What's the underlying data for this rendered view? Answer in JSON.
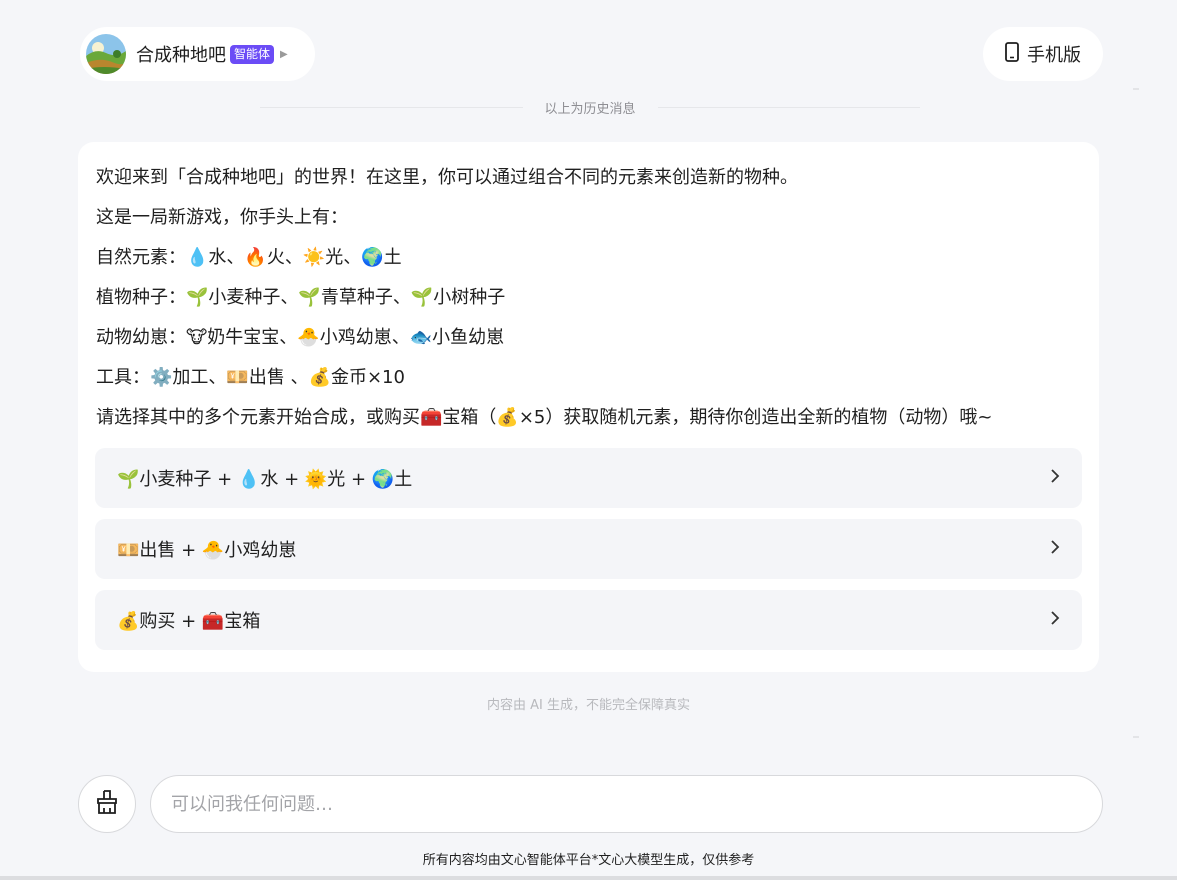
{
  "header": {
    "agent_name": "合成种地吧",
    "agent_badge": "智能体",
    "mobile_label": "手机版"
  },
  "history_divider": "以上为历史消息",
  "message": {
    "lines": [
      "欢迎来到「合成种地吧」的世界！在这里，你可以通过组合不同的元素来创造新的物种。",
      "这是一局新游戏，你手头上有：",
      "自然元素：💧水、🔥火、☀️光、🌍土",
      "植物种子：🌱小麦种子、🌱青草种子、🌱小树种子",
      "动物幼崽：🐮奶牛宝宝、🐣小鸡幼崽、🐟小鱼幼崽",
      "工具：⚙️加工、💴出售 、💰金币×10",
      "请选择其中的多个元素开始合成，或购买🧰宝箱（💰×5）获取随机元素，期待你创造出全新的植物（动物）哦~"
    ]
  },
  "suggestions": [
    "🌱小麦种子 + 💧水 + 🌞光 + 🌍土",
    "💴出售 + 🐣小鸡幼崽",
    "💰购买 + 🧰宝箱"
  ],
  "ai_note": "内容由 AI 生成，不能完全保障真实",
  "input": {
    "placeholder": "可以问我任何问题…"
  },
  "footer_note": "所有内容均由文心智能体平台*文心大模型生成，仅供参考",
  "icons": {
    "avatar": "farm-landscape-avatar",
    "mobile": "phone-icon",
    "tool": "broom-icon",
    "suggestion_arrow": "chevron-right-icon"
  },
  "colors": {
    "badge": "#6b4cf6",
    "background": "#f5f6f9"
  }
}
